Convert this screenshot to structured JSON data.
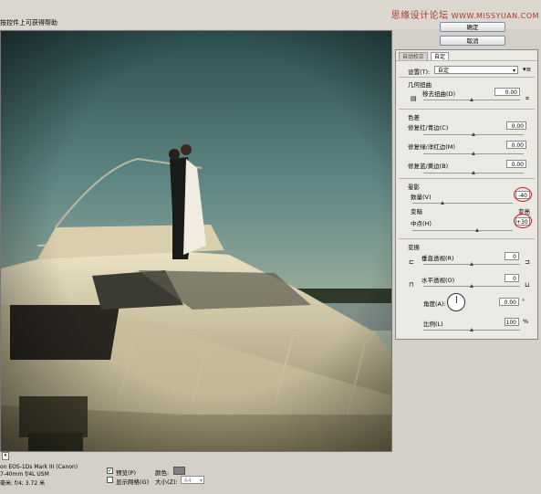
{
  "hint": "按控件上可获得帮助",
  "watermark": {
    "text": "思缘设计论坛",
    "site": "WWW.MISSYUAN.COM"
  },
  "buttons": {
    "ok": "确定",
    "cancel": "取消"
  },
  "tabs": {
    "auto": "自动校正",
    "custom": "自定"
  },
  "settings": {
    "label": "设置(T):",
    "value": "自定"
  },
  "geometric": {
    "section": "几何扭曲",
    "remove_distortion": "移去扭曲(D)",
    "remove_distortion_value": "0.00",
    "remove_distortion_level": 0.5
  },
  "chromatic": {
    "section": "色差",
    "rows": [
      {
        "label": "修复红/青边(C)",
        "value": "0.00",
        "level": 0.5
      },
      {
        "label": "修复绿/洋红边(M)",
        "value": "0.00",
        "level": 0.5
      },
      {
        "label": "修复蓝/黄边(B)",
        "value": "0.00",
        "level": 0.5
      }
    ]
  },
  "vignette": {
    "section": "晕影",
    "amount_label": "数量(V)",
    "amount_value": "-40",
    "amount_level": 0.3,
    "darken": "变暗",
    "lighten": "变亮",
    "midpoint_label": "中点(H)",
    "midpoint_value": "+30",
    "midpoint_level": 0.65
  },
  "transform": {
    "section": "变换",
    "vertical_label": "垂直透视(R)",
    "vertical_value": "0",
    "vertical_level": 0.5,
    "horizontal_label": "水平透视(O)",
    "horizontal_value": "0",
    "horizontal_level": 0.5,
    "angle_label": "角度(A):",
    "angle_value": "0.00",
    "angle_unit": "°",
    "scale_label": "比例(L)",
    "scale_value": "100",
    "scale_unit": "%",
    "scale_level": 0.5
  },
  "footer": {
    "camera": "on EOS-1Ds Mark III (Canon)",
    "lens": "7-40mm f/4L USM",
    "settings": "毫米; f/4; 3.72 米",
    "preview_label": "预览(P)",
    "preview_checked": true,
    "grid_label": "显示网格(G)",
    "grid_checked": false,
    "color_label": "颜色:",
    "size_label": "大小(Z):",
    "size_value": "64",
    "grid_color": "#808080"
  },
  "colors": {
    "accent_red": "#d8141e"
  }
}
